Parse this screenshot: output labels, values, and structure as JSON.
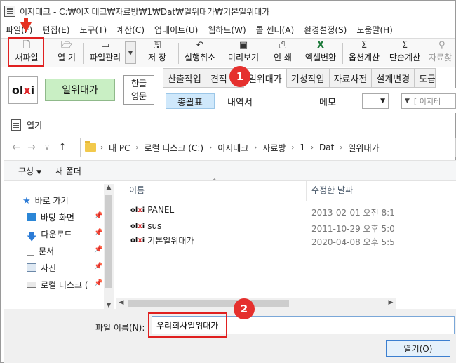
{
  "window": {
    "title": "이지테크 - C:₩이지테크₩자료방₩1₩Dat₩일위대가₩기본일위대가"
  },
  "menu": [
    "파일(F)",
    "편집(E)",
    "도구(T)",
    "계산(C)",
    "업데이트(U)",
    "웹하드(W)",
    "콜 센터(A)",
    "환경설정(S)",
    "도움말(H)"
  ],
  "toolbar": {
    "new_file": "새파일",
    "open": "열 기",
    "file_manage": "파일관리",
    "save": "저 장",
    "undo": "실행취소",
    "preview": "미리보기",
    "print": "인 쇄",
    "excel": "엑셀변환",
    "option_calc": "옵션계산",
    "simple_calc": "단순계산",
    "data": "자료찾"
  },
  "program": {
    "logo_text": "ol",
    "logo_accent": "x",
    "logo_tail": "i",
    "main_button": "일위대가",
    "lang_top": "한글",
    "lang_bottom": "영문",
    "tabs": [
      "산출작업",
      "견적",
      "일위대가",
      "기성작업",
      "자료사전",
      "설계변경",
      "도급"
    ],
    "subtabs": {
      "summary": "총괄표",
      "detail": "내역서",
      "memo": "메모",
      "combo_text": "[ 이지테"
    }
  },
  "dialog": {
    "title": "열기",
    "breadcrumb": [
      "내 PC",
      "로컬 디스크 (C:)",
      "이지테크",
      "자료방",
      "1",
      "Dat",
      "일위대가"
    ],
    "organize": "구성",
    "new_folder": "새 폴더",
    "nav_items": [
      "바로 가기",
      "바탕 화면",
      "다운로드",
      "문서",
      "사진",
      "로컬 디스크 ("
    ],
    "columns": {
      "name": "이름",
      "modified": "수정한 날짜"
    },
    "files": [
      {
        "name": "PANEL",
        "date": "2013-02-01 오전 8:1"
      },
      {
        "name": "sus",
        "date": "2011-10-29 오후 5:0"
      },
      {
        "name": "기본일위대가",
        "date": "2020-04-08 오후 5:5"
      }
    ],
    "filename_label": "파일 이름(N):",
    "filename_value": "우리회사일위대가",
    "open_button": "열기(O)"
  },
  "annotations": {
    "step1": "1",
    "step2": "2"
  },
  "colors": {
    "highlight_red": "#e02020",
    "badge_red": "#e5302e",
    "active_green": "#c9efc4"
  }
}
